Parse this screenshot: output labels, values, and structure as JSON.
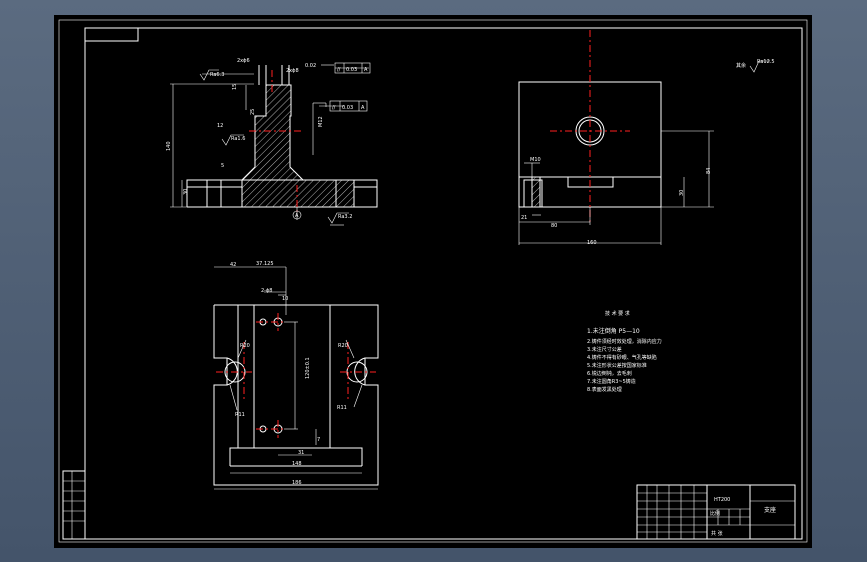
{
  "colors": {
    "background": "#000000",
    "lines": "#ffffff",
    "centerlines": "#ff2020",
    "window": "#5b6b80"
  },
  "front_view": {
    "roughness_top": "Ra6.3",
    "width_label": "2xϕ6",
    "fit_label": "2xϕ8",
    "fit_tol": "0.02",
    "tol_box1": [
      "//",
      "0.03",
      "A"
    ],
    "tol_box2": [
      "//",
      "0.03",
      "A"
    ],
    "dim_height": "140",
    "dim_base": "30",
    "dim_a": "15",
    "dim_b": "25",
    "dim_c": "12",
    "dim_m": "M12",
    "roughness_mid": "Ra1.6",
    "roughness_bot": "Ra3.2",
    "datum": "A",
    "small_5": "5"
  },
  "side_view": {
    "dim_m": "M10",
    "dim_21": "21",
    "dim_80": "80",
    "dim_160": "160",
    "dim_30": "30",
    "dim_84": "84"
  },
  "corner_roughness": {
    "prefix": "其余",
    "value": "Ra12.5"
  },
  "top_view": {
    "dim_42": "42",
    "dim_37": "37.125",
    "dim_hole": "2-ϕ8",
    "dim_10": "10",
    "dim_120": "120±0.1",
    "dim_r20a": "R20",
    "dim_r20b": "R20",
    "dim_r11a": "R11",
    "dim_r11b": "R11",
    "dim_31": "31",
    "dim_7": "7",
    "dim_148": "148",
    "dim_186": "186"
  },
  "notes": {
    "title": "技 术 要 求",
    "lines": [
      "1.未注倒角 P5—10",
      "2.铸件须经时效处理，消除内应力",
      "3.未注尺寸公差",
      "4.铸件不得有砂眼、气孔等缺陷",
      "5.未注形状公差按国家标准",
      "6.锐边倒钝，去毛刺",
      "7.未注圆角R3~5铸造",
      "8.表面发黑处理"
    ]
  },
  "title_block": {
    "material": "HT200",
    "drawing_name": "支座",
    "scale_label": "比例",
    "sheet_label": "共 张"
  }
}
